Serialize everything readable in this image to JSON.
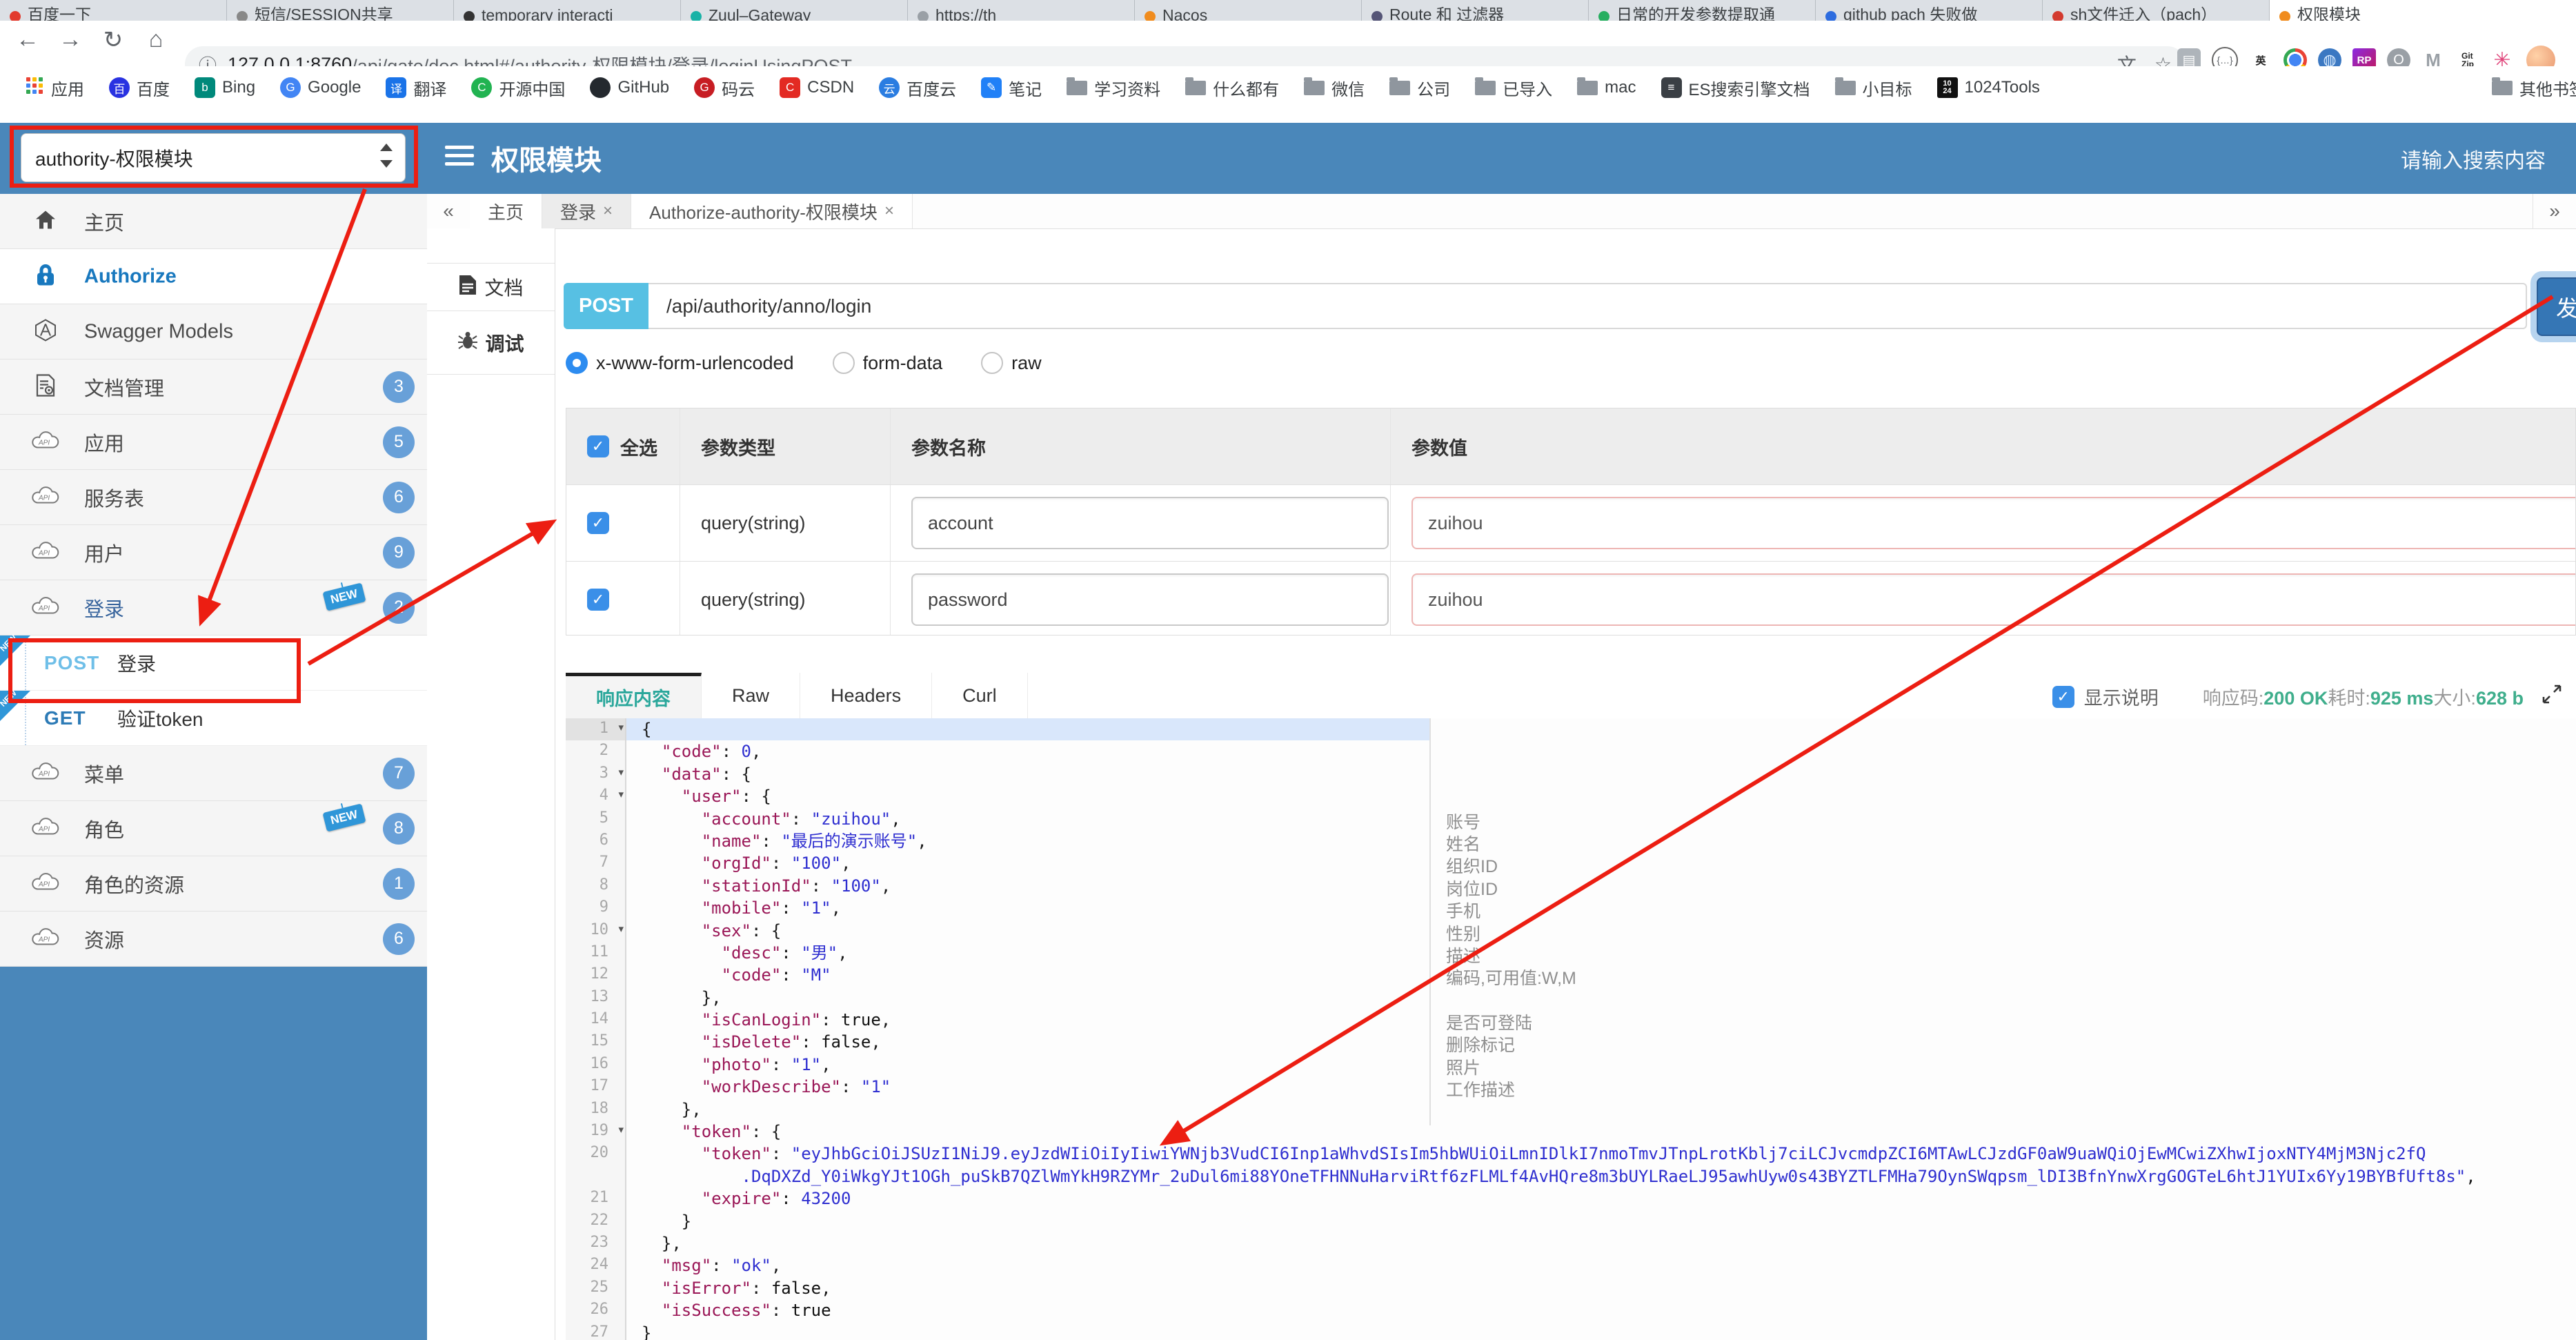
{
  "colors": {
    "blue": "#4a87ba",
    "badge": "#68a0d8",
    "newtag": "#2f96d8",
    "cyan": "#57c0e3",
    "green": "#3fae8c",
    "key": "#9a1757",
    "str": "#2f2fd0",
    "red": "#ec1e12"
  },
  "icons": {
    "back": "←",
    "forward": "→",
    "reload": "↻",
    "home": "⌂",
    "info": "ⓘ",
    "star": "☆",
    "collapse": "«",
    "expand_tabs": "»",
    "close": "×",
    "caret": "▾",
    "check": "✓",
    "translate": "文"
  },
  "browser": {
    "tabs": [
      {
        "title": "百度一下",
        "color": "#e23b2e"
      },
      {
        "title": "短信/SESSION共享",
        "color": "#888888"
      },
      {
        "title": "temporary interacti",
        "color": "#333333"
      },
      {
        "title": "Zuul–Gateway",
        "color": "#18b2a6"
      },
      {
        "title": "https://th",
        "color": "#9aa0a6"
      },
      {
        "title": "Nacos",
        "color": "#f08c1e"
      },
      {
        "title": "Route 和 过滤器",
        "color": "#555577"
      },
      {
        "title": "日常的开发参数提取通",
        "color": "#27ae60"
      },
      {
        "title": "github pach 失败做",
        "color": "#2d6cdf"
      },
      {
        "title": "sh文件迁入（pach）",
        "color": "#d33a2f"
      },
      {
        "title": "权限模块",
        "color": "#f08c1e",
        "active": true
      }
    ],
    "url_host": "127.0.0.1:8760",
    "url_rest": "/api/gate/doc.html#/authority-权限模块/登录/loginUsingPOST",
    "bookmarks": [
      {
        "label": "应用",
        "type": "grid"
      },
      {
        "label": "百度",
        "type": "fav",
        "shape": "circle",
        "color": "#2932e1",
        "glyph": "百"
      },
      {
        "label": "Bing",
        "type": "fav",
        "shape": "square",
        "color": "#00897b",
        "glyph": "b"
      },
      {
        "label": "Google",
        "type": "fav",
        "shape": "circle",
        "color": "#4285f4",
        "glyph": "G"
      },
      {
        "label": "翻译",
        "type": "fav",
        "shape": "square",
        "color": "#1a73e8",
        "glyph": "译"
      },
      {
        "label": "开源中国",
        "type": "fav",
        "shape": "circle",
        "color": "#21b351",
        "glyph": "C"
      },
      {
        "label": "GitHub",
        "type": "fav",
        "shape": "circle",
        "color": "#24292e",
        "glyph": ""
      },
      {
        "label": "码云",
        "type": "fav",
        "shape": "circle",
        "color": "#c71d23",
        "glyph": "G"
      },
      {
        "label": "CSDN",
        "type": "fav",
        "shape": "square",
        "color": "#e32a23",
        "glyph": "C"
      },
      {
        "label": "百度云",
        "type": "fav",
        "shape": "circle",
        "color": "#2b7de1",
        "glyph": "云"
      },
      {
        "label": "笔记",
        "type": "fav",
        "shape": "square",
        "color": "#2080f7",
        "glyph": "✎"
      },
      {
        "label": "学习资料",
        "type": "folder"
      },
      {
        "label": "什么都有",
        "type": "folder"
      },
      {
        "label": "微信",
        "type": "folder"
      },
      {
        "label": "公司",
        "type": "folder"
      },
      {
        "label": "已导入",
        "type": "folder"
      },
      {
        "label": "mac",
        "type": "folder"
      },
      {
        "label": "ES搜索引擎文档",
        "type": "fav",
        "shape": "square",
        "color": "#3a3f44",
        "glyph": "≡"
      },
      {
        "label": "小目标",
        "type": "folder"
      },
      {
        "label": "1024Tools",
        "type": "stack",
        "color": "#111111",
        "lines": [
          "10",
          "24"
        ]
      }
    ],
    "overflow_bookmark": "其他书签"
  },
  "header": {
    "module_select_value": "authority-权限模块",
    "title": "权限模块",
    "search_placeholder": "请输入搜索内容"
  },
  "sidebar": {
    "items": [
      {
        "label": "主页",
        "icon": "home"
      },
      {
        "label": "Authorize",
        "icon": "lock",
        "style": "auth"
      },
      {
        "label": "Swagger Models",
        "icon": "hex"
      },
      {
        "label": "文档管理",
        "icon": "docgear",
        "badge": "3"
      },
      {
        "label": "应用",
        "icon": "cloud",
        "badge": "5"
      },
      {
        "label": "服务表",
        "icon": "cloud",
        "badge": "6"
      },
      {
        "label": "用户",
        "icon": "cloud",
        "badge": "9"
      },
      {
        "label": "登录",
        "icon": "cloud",
        "badge": "2",
        "isNew": true,
        "style": "selgrp"
      },
      {
        "type": "op",
        "method": "POST",
        "label": "登录",
        "isNew": true
      },
      {
        "type": "op",
        "method": "GET",
        "label": "验证token",
        "isNew": true
      },
      {
        "label": "菜单",
        "icon": "cloud",
        "badge": "7"
      },
      {
        "label": "角色",
        "icon": "cloud",
        "badge": "8",
        "isNew": true
      },
      {
        "label": "角色的资源",
        "icon": "cloud",
        "badge": "1"
      },
      {
        "label": "资源",
        "icon": "cloud",
        "badge": "6"
      }
    ],
    "new_tag_text": "NEW"
  },
  "rail": {
    "items": [
      {
        "label": "文档",
        "icon": "doc"
      },
      {
        "label": "调试",
        "icon": "bug",
        "active": true
      }
    ]
  },
  "doc_tabs": {
    "tabs": [
      {
        "label": "主页"
      },
      {
        "label": "登录",
        "closable": true,
        "active": true
      },
      {
        "label": "Authorize-authority-权限模块",
        "closable": true
      }
    ]
  },
  "endpoint": {
    "method": "POST",
    "path": "/api/authority/anno/login",
    "send_label": "发送"
  },
  "content_types": {
    "options": [
      "x-www-form-urlencoded",
      "form-data",
      "raw"
    ],
    "selected": 0
  },
  "params": {
    "headers": {
      "all": "全选",
      "type": "参数类型",
      "name": "参数名称",
      "value": "参数值"
    },
    "rows": [
      {
        "checked": true,
        "type": "query(string)",
        "name": "account",
        "value": "zuihou"
      },
      {
        "checked": true,
        "type": "query(string)",
        "name": "password",
        "value": "zuihou"
      }
    ]
  },
  "response": {
    "tabs": [
      "响应内容",
      "Raw",
      "Headers",
      "Curl"
    ],
    "active_tab": 0,
    "show_desc_label": "显示说明",
    "show_desc_checked": true,
    "status": [
      {
        "label": "响应码:",
        "value": "200 OK"
      },
      {
        "label": "耗时:",
        "value": "925 ms"
      },
      {
        "label": "大小:",
        "value": "628 b"
      }
    ]
  },
  "json_viewer": {
    "lines": [
      {
        "n": 1,
        "fold": true,
        "hl": true,
        "t": "{"
      },
      {
        "n": 2,
        "t": "  \"code\": 0,"
      },
      {
        "n": 3,
        "fold": true,
        "t": "  \"data\": {"
      },
      {
        "n": 4,
        "fold": true,
        "t": "    \"user\": {"
      },
      {
        "n": 5,
        "t": "      \"account\": \"zuihou\",",
        "note": "账号"
      },
      {
        "n": 6,
        "t": "      \"name\": \"最后的演示账号\",",
        "note": "姓名"
      },
      {
        "n": 7,
        "t": "      \"orgId\": \"100\",",
        "note": "组织ID"
      },
      {
        "n": 8,
        "t": "      \"stationId\": \"100\",",
        "note": "岗位ID"
      },
      {
        "n": 9,
        "t": "      \"mobile\": \"1\",",
        "note": "手机"
      },
      {
        "n": 10,
        "fold": true,
        "t": "      \"sex\": {",
        "note": "性别"
      },
      {
        "n": 11,
        "t": "        \"desc\": \"男\",",
        "note": "描述"
      },
      {
        "n": 12,
        "t": "        \"code\": \"M\"",
        "note": "编码,可用值:W,M"
      },
      {
        "n": 13,
        "t": "      },"
      },
      {
        "n": 14,
        "t": "      \"isCanLogin\": true,",
        "note": "是否可登陆"
      },
      {
        "n": 15,
        "t": "      \"isDelete\": false,",
        "note": "删除标记"
      },
      {
        "n": 16,
        "t": "      \"photo\": \"1\",",
        "note": "照片"
      },
      {
        "n": 17,
        "t": "      \"workDescribe\": \"1\"",
        "note": "工作描述"
      },
      {
        "n": 18,
        "t": "    },"
      },
      {
        "n": 19,
        "fold": true,
        "t": "    \"token\": {"
      },
      {
        "n": 20,
        "t": "      \"token\": \"eyJhbGciOiJSUzI1NiJ9.eyJzdWIiOiIyIiwiYWNjb3VudCI6Inp1aWhvdSIsIm5hbWUiOiLmnIDlkI7nmoTmvJTnpLrotKblj7ciLCJvcmdpZCI6MTAwLCJzdGF0aW9uaWQiOjEwMCwiZXhwIjoxNTY4MjM3Njc2fQ"
      },
      {
        "n": null,
        "t": "          .DqDXZd_Y0iWkgYJt1OGh_puSkB7QZlWmYkH9RZYMr_2uDul6mi88YOneTFHNNuHarviRtf6zFLMLf4AvHQre8m3bUYLRaeLJ95awhUyw0s43BYZTLFMHa79OynSWqpsm_lDI3BfnYnwXrgGOGTeL6htJ1YUIx6Yy19BYBfUft8s\","
      },
      {
        "n": 21,
        "t": "      \"expire\": 43200"
      },
      {
        "n": 22,
        "t": "    }"
      },
      {
        "n": 23,
        "t": "  },"
      },
      {
        "n": 24,
        "t": "  \"msg\": \"ok\","
      },
      {
        "n": 25,
        "t": "  \"isError\": false,"
      },
      {
        "n": 26,
        "t": "  \"isSuccess\": true"
      },
      {
        "n": 27,
        "t": "}"
      }
    ]
  }
}
